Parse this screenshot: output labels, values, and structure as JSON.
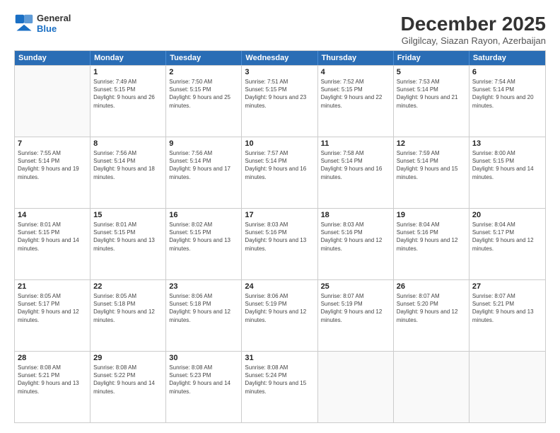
{
  "logo": {
    "line1": "General",
    "line2": "Blue"
  },
  "title": "December 2025",
  "subtitle": "Gilgilcay, Siazan Rayon, Azerbaijan",
  "headers": [
    "Sunday",
    "Monday",
    "Tuesday",
    "Wednesday",
    "Thursday",
    "Friday",
    "Saturday"
  ],
  "weeks": [
    [
      {
        "day": "",
        "empty": true
      },
      {
        "day": "1",
        "sunrise": "7:49 AM",
        "sunset": "5:15 PM",
        "daylight": "9 hours and 26 minutes."
      },
      {
        "day": "2",
        "sunrise": "7:50 AM",
        "sunset": "5:15 PM",
        "daylight": "9 hours and 25 minutes."
      },
      {
        "day": "3",
        "sunrise": "7:51 AM",
        "sunset": "5:15 PM",
        "daylight": "9 hours and 23 minutes."
      },
      {
        "day": "4",
        "sunrise": "7:52 AM",
        "sunset": "5:15 PM",
        "daylight": "9 hours and 22 minutes."
      },
      {
        "day": "5",
        "sunrise": "7:53 AM",
        "sunset": "5:14 PM",
        "daylight": "9 hours and 21 minutes."
      },
      {
        "day": "6",
        "sunrise": "7:54 AM",
        "sunset": "5:14 PM",
        "daylight": "9 hours and 20 minutes."
      }
    ],
    [
      {
        "day": "7",
        "sunrise": "7:55 AM",
        "sunset": "5:14 PM",
        "daylight": "9 hours and 19 minutes."
      },
      {
        "day": "8",
        "sunrise": "7:56 AM",
        "sunset": "5:14 PM",
        "daylight": "9 hours and 18 minutes."
      },
      {
        "day": "9",
        "sunrise": "7:56 AM",
        "sunset": "5:14 PM",
        "daylight": "9 hours and 17 minutes."
      },
      {
        "day": "10",
        "sunrise": "7:57 AM",
        "sunset": "5:14 PM",
        "daylight": "9 hours and 16 minutes."
      },
      {
        "day": "11",
        "sunrise": "7:58 AM",
        "sunset": "5:14 PM",
        "daylight": "9 hours and 16 minutes."
      },
      {
        "day": "12",
        "sunrise": "7:59 AM",
        "sunset": "5:14 PM",
        "daylight": "9 hours and 15 minutes."
      },
      {
        "day": "13",
        "sunrise": "8:00 AM",
        "sunset": "5:15 PM",
        "daylight": "9 hours and 14 minutes."
      }
    ],
    [
      {
        "day": "14",
        "sunrise": "8:01 AM",
        "sunset": "5:15 PM",
        "daylight": "9 hours and 14 minutes."
      },
      {
        "day": "15",
        "sunrise": "8:01 AM",
        "sunset": "5:15 PM",
        "daylight": "9 hours and 13 minutes."
      },
      {
        "day": "16",
        "sunrise": "8:02 AM",
        "sunset": "5:15 PM",
        "daylight": "9 hours and 13 minutes."
      },
      {
        "day": "17",
        "sunrise": "8:03 AM",
        "sunset": "5:16 PM",
        "daylight": "9 hours and 13 minutes."
      },
      {
        "day": "18",
        "sunrise": "8:03 AM",
        "sunset": "5:16 PM",
        "daylight": "9 hours and 12 minutes."
      },
      {
        "day": "19",
        "sunrise": "8:04 AM",
        "sunset": "5:16 PM",
        "daylight": "9 hours and 12 minutes."
      },
      {
        "day": "20",
        "sunrise": "8:04 AM",
        "sunset": "5:17 PM",
        "daylight": "9 hours and 12 minutes."
      }
    ],
    [
      {
        "day": "21",
        "sunrise": "8:05 AM",
        "sunset": "5:17 PM",
        "daylight": "9 hours and 12 minutes."
      },
      {
        "day": "22",
        "sunrise": "8:05 AM",
        "sunset": "5:18 PM",
        "daylight": "9 hours and 12 minutes."
      },
      {
        "day": "23",
        "sunrise": "8:06 AM",
        "sunset": "5:18 PM",
        "daylight": "9 hours and 12 minutes."
      },
      {
        "day": "24",
        "sunrise": "8:06 AM",
        "sunset": "5:19 PM",
        "daylight": "9 hours and 12 minutes."
      },
      {
        "day": "25",
        "sunrise": "8:07 AM",
        "sunset": "5:19 PM",
        "daylight": "9 hours and 12 minutes."
      },
      {
        "day": "26",
        "sunrise": "8:07 AM",
        "sunset": "5:20 PM",
        "daylight": "9 hours and 12 minutes."
      },
      {
        "day": "27",
        "sunrise": "8:07 AM",
        "sunset": "5:21 PM",
        "daylight": "9 hours and 13 minutes."
      }
    ],
    [
      {
        "day": "28",
        "sunrise": "8:08 AM",
        "sunset": "5:21 PM",
        "daylight": "9 hours and 13 minutes."
      },
      {
        "day": "29",
        "sunrise": "8:08 AM",
        "sunset": "5:22 PM",
        "daylight": "9 hours and 14 minutes."
      },
      {
        "day": "30",
        "sunrise": "8:08 AM",
        "sunset": "5:23 PM",
        "daylight": "9 hours and 14 minutes."
      },
      {
        "day": "31",
        "sunrise": "8:08 AM",
        "sunset": "5:24 PM",
        "daylight": "9 hours and 15 minutes."
      },
      {
        "day": "",
        "empty": true
      },
      {
        "day": "",
        "empty": true
      },
      {
        "day": "",
        "empty": true
      }
    ]
  ]
}
